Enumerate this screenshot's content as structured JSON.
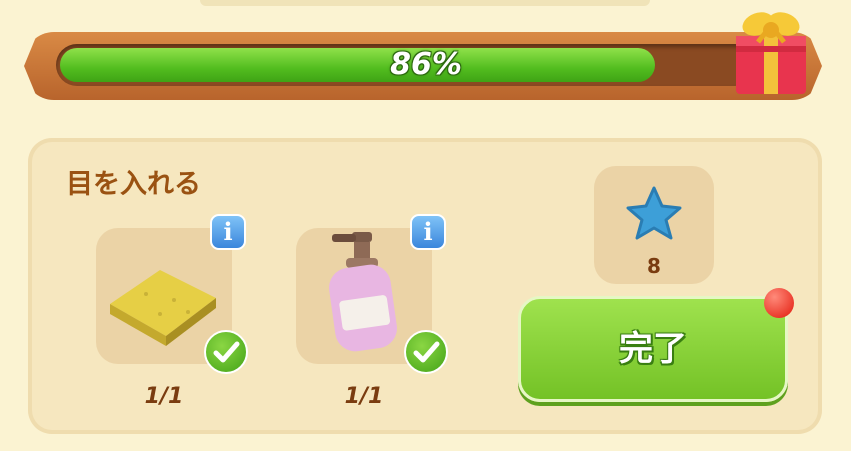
{
  "progress": {
    "value": 0.86,
    "label": "86%"
  },
  "task": {
    "title": "目を入れる",
    "items": [
      {
        "name": "sponge",
        "count": "1/1",
        "completed": true,
        "info_label": "i"
      },
      {
        "name": "soap-bottle",
        "count": "1/1",
        "completed": true,
        "info_label": "i"
      }
    ]
  },
  "reward": {
    "icon": "blue-star-icon",
    "count": "8"
  },
  "done_button": {
    "label": "完了",
    "has_notification": true
  },
  "colors": {
    "progress_fill": "#52bd1f",
    "frame": "#c3703a",
    "panel": "#f6e7bf",
    "button": "#7cc62c",
    "title": "#9a5212",
    "notification": "#e21a0c"
  }
}
